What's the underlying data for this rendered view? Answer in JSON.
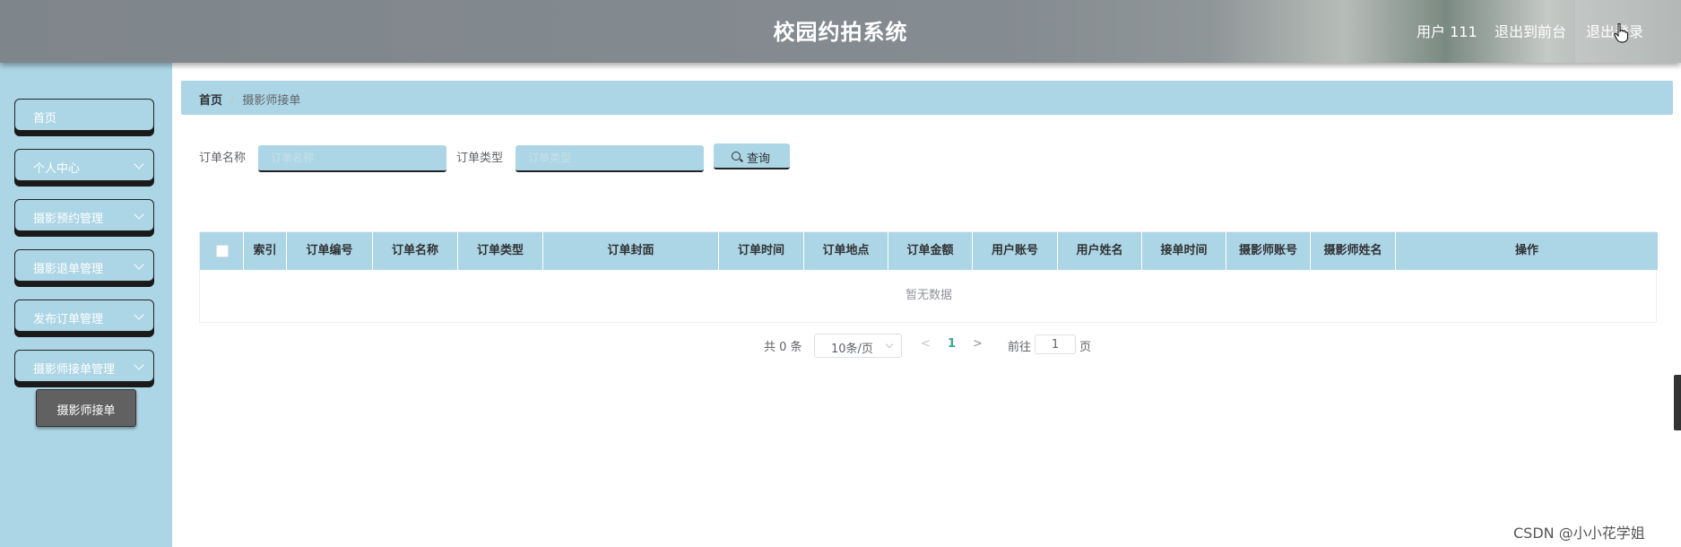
{
  "header": {
    "title": "校园约拍系统",
    "user": "用户 111",
    "front_label": "退出到前台",
    "logout_label": "退出登录"
  },
  "sidebar": {
    "items": [
      {
        "label": "首页"
      },
      {
        "label": "个人中心"
      },
      {
        "label": "摄影预约管理"
      },
      {
        "label": "摄影退单管理"
      },
      {
        "label": "发布订单管理"
      },
      {
        "label": "摄影师接单管理"
      }
    ],
    "sub_item": "摄影师接单"
  },
  "breadcrumb": {
    "home": "首页",
    "separator": "/",
    "current": "摄影师接单"
  },
  "search": {
    "name_label": "订单名称",
    "name_placeholder": "订单名称",
    "type_label": "订单类型",
    "type_placeholder": "订单类型",
    "query_label": "查询"
  },
  "table": {
    "columns": [
      "索引",
      "订单编号",
      "订单名称",
      "订单类型",
      "订单封面",
      "订单时间",
      "订单地点",
      "订单金额",
      "用户账号",
      "用户姓名",
      "接单时间",
      "摄影师账号",
      "摄影师姓名",
      "操作"
    ],
    "empty_text": "暂无数据"
  },
  "pagination": {
    "total": "共 0 条",
    "page_size": "10条/页",
    "prev": "<",
    "current_page": "1",
    "next": ">",
    "goto_label": "前往",
    "goto_value": "1",
    "page_label": "页"
  },
  "watermark": "CSDN @小小花学姐",
  "colors": {
    "accent": "#acd6e6",
    "active_page": "#37a98a",
    "sub_item_bg": "#616161"
  }
}
